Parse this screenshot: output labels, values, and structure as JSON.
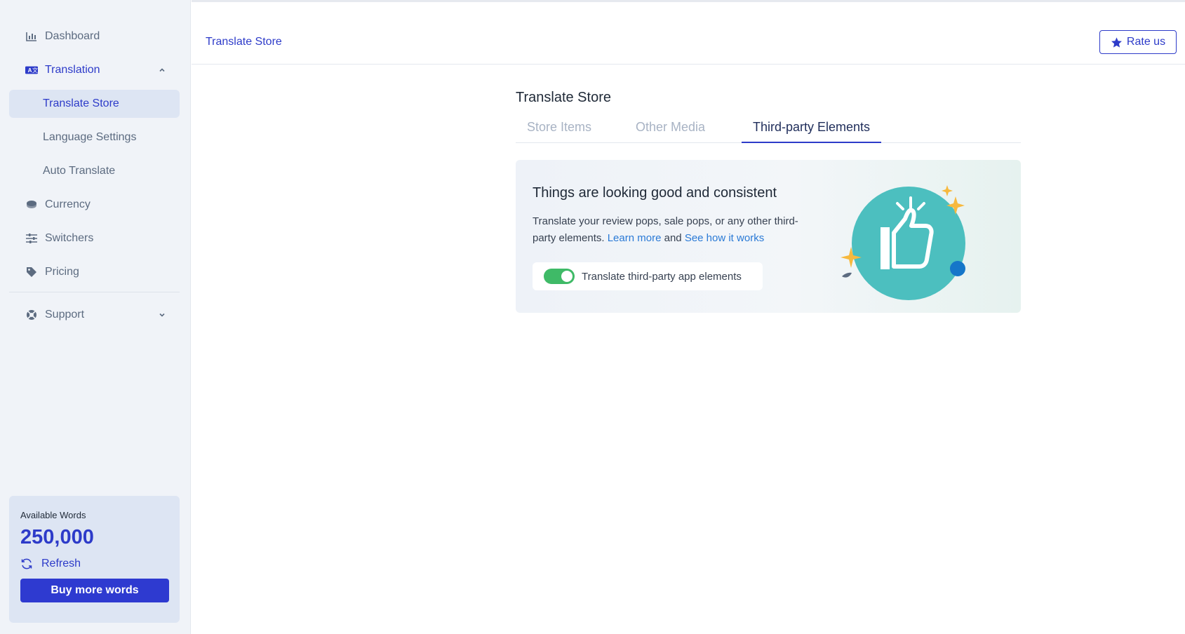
{
  "sidebar": {
    "items": [
      {
        "label": "Dashboard",
        "icon": "bar-chart-icon"
      },
      {
        "label": "Translation",
        "icon": "translate-icon"
      },
      {
        "label": "Currency",
        "icon": "coins-icon"
      },
      {
        "label": "Switchers",
        "icon": "sliders-icon"
      },
      {
        "label": "Pricing",
        "icon": "tag-icon"
      },
      {
        "label": "Support",
        "icon": "lifebuoy-icon"
      }
    ],
    "translation_sub": [
      {
        "label": "Translate Store"
      },
      {
        "label": "Language Settings"
      },
      {
        "label": "Auto Translate"
      }
    ]
  },
  "words": {
    "label": "Available Words",
    "count": "250,000",
    "refresh_label": "Refresh",
    "buy_label": "Buy more words"
  },
  "header": {
    "breadcrumb": "Translate Store",
    "rate_label": "Rate us"
  },
  "main": {
    "title": "Translate Store",
    "tabs": [
      {
        "label": "Store Items"
      },
      {
        "label": "Other Media"
      },
      {
        "label": "Third-party Elements"
      }
    ],
    "card": {
      "title": "Things are looking good and consistent",
      "desc_part1": "Translate your review pops, sale pops, or any other third-party elements.",
      "learn_more": "Learn more",
      "and": "and",
      "see_how": "See how it works",
      "toggle_label": "Translate third-party app elements"
    }
  },
  "colors": {
    "accent": "#2d3bc9",
    "toggle_on": "#3fba67",
    "illustration": "#4cbfbf"
  }
}
